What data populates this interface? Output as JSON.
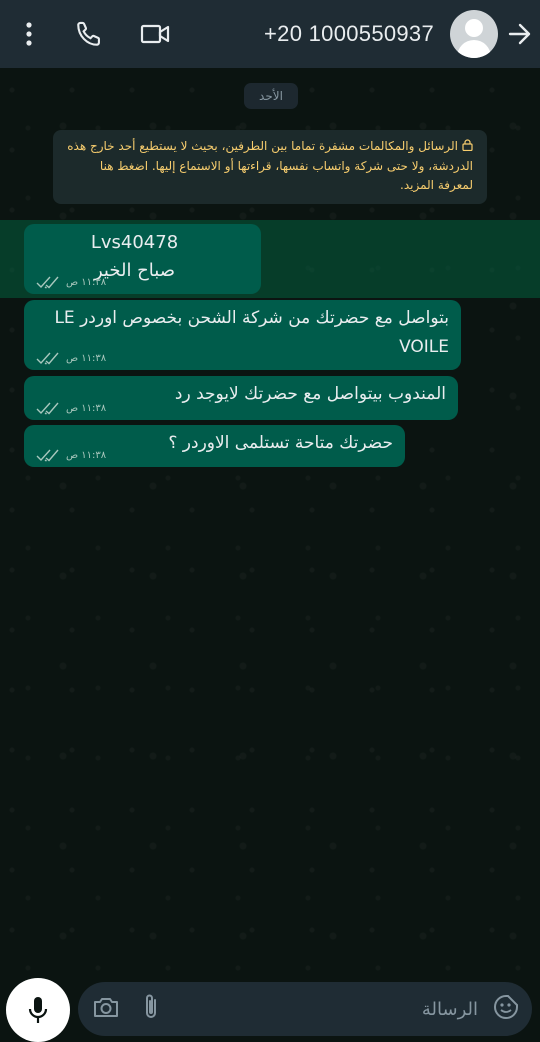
{
  "header": {
    "contact_number": "+20 1000550937",
    "icons": [
      "more-options-icon",
      "phone-icon",
      "video-camera-icon",
      "avatar",
      "back-arrow-icon"
    ]
  },
  "chat": {
    "date_label": "الأحد",
    "encryption_notice": "الرسائل والمكالمات مشفرة تماما بين الطرفين، بحيث لا يستطيع أحد خارج هذه الدردشة، ولا حتى شركة واتساب نفسها، قراءتها أو الاستماع إليها. اضغط هنا لمعرفة المزيد.",
    "messages": [
      {
        "text": "Lvs40478\nصباح الخير",
        "time": "١١:٣٨ ص",
        "status": "delivered"
      },
      {
        "text": "بتواصل مع حضرتك من شركة الشحن بخصوص اوردر LE VOILE",
        "time": "١١:٣٨ ص",
        "status": "delivered"
      },
      {
        "text": "المندوب بيتواصل مع حضرتك لايوجد رد",
        "time": "١١:٣٨ ص",
        "status": "delivered"
      },
      {
        "text": "حضرتك متاحة تستلمى الاوردر ؟",
        "time": "١١:٣٨ ص",
        "status": "delivered"
      }
    ]
  },
  "input": {
    "placeholder": "الرسالة"
  },
  "colors": {
    "header_bg": "#1f2c34",
    "bubble_outgoing": "#005c4b",
    "notice_text": "#f7cd6e",
    "background": "#0b1411"
  }
}
